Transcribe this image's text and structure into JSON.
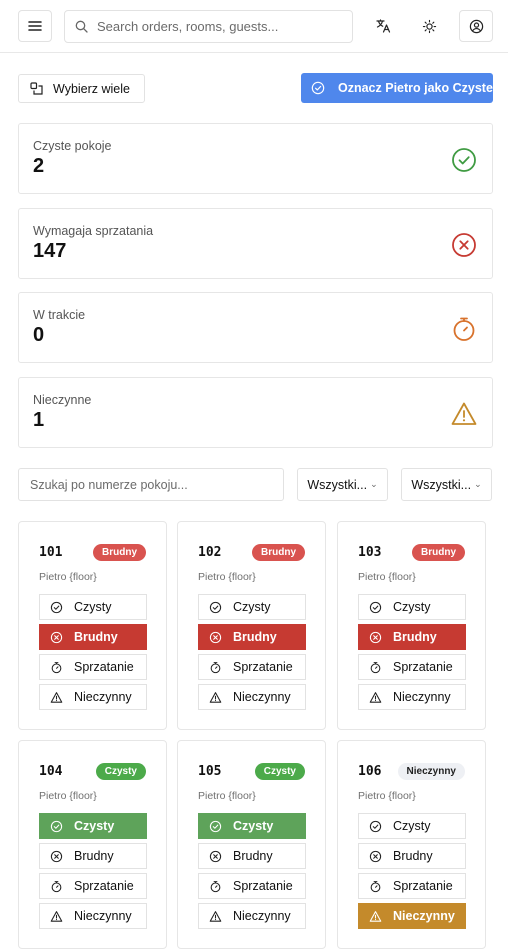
{
  "header": {
    "search_placeholder": "Search orders, rooms, guests..."
  },
  "actions": {
    "select_many": "Wybierz wiele",
    "mark_floor_clean": "Oznacz Pietro jako Czyste"
  },
  "stats": [
    {
      "label": "Czyste pokoje",
      "value": "2",
      "icon": "check-circle-icon",
      "color": "#3f9b42"
    },
    {
      "label": "Wymagaja sprzatania",
      "value": "147",
      "icon": "x-circle-icon",
      "color": "#c63a32"
    },
    {
      "label": "W trakcie",
      "value": "0",
      "icon": "timer-icon",
      "color": "#d8722c"
    },
    {
      "label": "Nieczynne",
      "value": "1",
      "icon": "warning-icon",
      "color": "#c48a2b"
    }
  ],
  "filters": {
    "room_search_placeholder": "Szukaj po numerze pokoju...",
    "status_select": "Wszystki...",
    "floor_select": "Wszystki..."
  },
  "status_options": [
    "Czysty",
    "Brudny",
    "Sprzatanie",
    "Nieczynny"
  ],
  "rooms": [
    {
      "number": "101",
      "status": "Brudny",
      "floor": "Pietro {floor}",
      "active": 1
    },
    {
      "number": "102",
      "status": "Brudny",
      "floor": "Pietro {floor}",
      "active": 1
    },
    {
      "number": "103",
      "status": "Brudny",
      "floor": "Pietro {floor}",
      "active": 1
    },
    {
      "number": "104",
      "status": "Czysty",
      "floor": "Pietro {floor}",
      "active": 0
    },
    {
      "number": "105",
      "status": "Czysty",
      "floor": "Pietro {floor}",
      "active": 0
    },
    {
      "number": "106",
      "status": "Nieczynny",
      "floor": "Pietro {floor}",
      "active": 3
    }
  ],
  "colors": {
    "primary": "#4f87ec",
    "dirty": "#c63a32",
    "clean": "#5ea35a",
    "out_of_order": "#c48a2b"
  }
}
